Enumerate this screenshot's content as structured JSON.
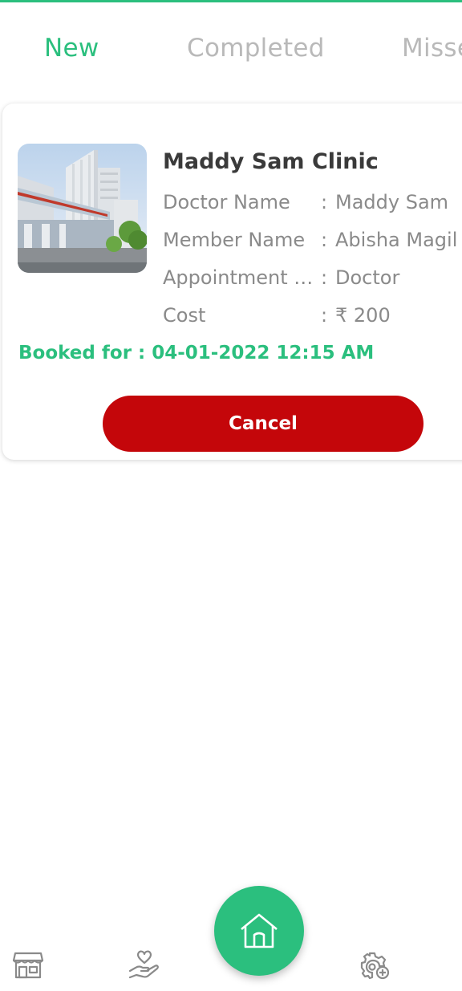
{
  "tabs": [
    {
      "label": "New",
      "active": true
    },
    {
      "label": "Completed",
      "active": false
    },
    {
      "label": "Missed",
      "active": false
    }
  ],
  "appointment": {
    "clinic_name": "Maddy Sam Clinic",
    "rows": [
      {
        "label": "Doctor Name",
        "value": "Maddy Sam"
      },
      {
        "label": "Member Name",
        "value": "Abisha Magil"
      },
      {
        "label": "Appointment Type",
        "value": "Doctor"
      },
      {
        "label": "Cost",
        "value": "₹ 200"
      }
    ],
    "booked_for": "Booked for : 04-01-2022 12:15 AM",
    "cancel_label": "Cancel"
  },
  "colors": {
    "accent": "#2bbf7e",
    "cancel": "#c4060a"
  },
  "bottom_nav": {
    "items": [
      "store-icon",
      "care-hand-icon",
      "home-icon",
      "settings-icon"
    ]
  }
}
